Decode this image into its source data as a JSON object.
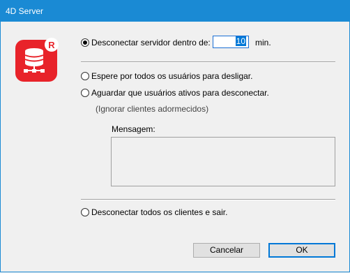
{
  "window": {
    "title": "4D Server"
  },
  "options": {
    "disconnect_within": {
      "label": "Desconectar servidor dentro de:",
      "value": "10",
      "unit": "min."
    },
    "wait_all_users": {
      "label": "Espere por todos os usuários para desligar."
    },
    "wait_active_users": {
      "label": "Aguardar que usuários ativos para desconectar.",
      "hint": "(Ignorar clientes adormecidos)"
    },
    "message": {
      "label": "Mensagem:",
      "value": ""
    },
    "disconnect_all": {
      "label": "Desconectar todos os clientes e sair."
    }
  },
  "buttons": {
    "cancel": "Cancelar",
    "ok": "OK"
  },
  "icon": {
    "name": "4d-server-icon",
    "badge": "R",
    "color": "#e8232a"
  },
  "selected_option": "disconnect_within"
}
